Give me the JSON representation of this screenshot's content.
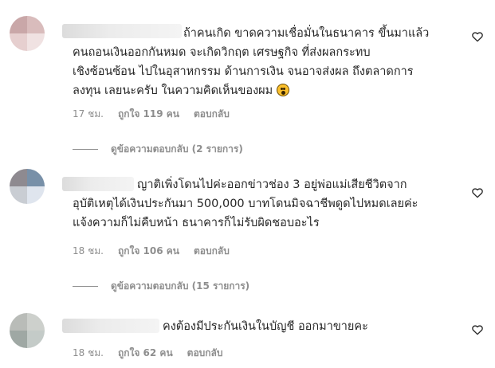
{
  "comments": [
    {
      "lines": [
        "ถ้าคนเกิด ขาดความเชื่อมั่นในธนาคาร ขึ้นมาแล้ว",
        "คนถอนเงินออกกันหมด จะเกิดวิกฤต เศรษฐกิจ ที่ส่งผลกระทบ",
        "เชิงซ้อนซ้อน ไปในอุสาหกรรม ด้านการเงิน จนอาจส่งผล ถึงตลาดการ",
        "ลงทุน เลยนะครับ ในความคิดเห็นของผม"
      ],
      "emoji": "astonished-face-icon",
      "time": "17 ชม.",
      "likes": "ถูกใจ 119 คน",
      "reply": "ตอบกลับ",
      "view_replies": "ดูข้อความตอบกลับ (2 รายการ)"
    },
    {
      "lines": [
        "ญาติเพิ่งโดนไปค่ะออกข่าวช่อง 3 อยู่พ่อแม่เสียชีวิตจาก",
        "อุบัติเหตุได้เงินประกันมา 500,000 บาทโดนมิจฉาชีพดูดไปหมดเลยค่ะ",
        "แจ้งความก็ไม่คืบหน้า ธนาคารก็ไม่รับผิดชอบอะไร"
      ],
      "time": "18 ชม.",
      "likes": "ถูกใจ 106 คน",
      "reply": "ตอบกลับ",
      "view_replies": "ดูข้อความตอบกลับ (15 รายการ)"
    },
    {
      "lines": [
        "คงต้องมีประกันเงินในบัญชี ออกมาขายคะ"
      ],
      "time": "18 ชม.",
      "likes": "ถูกใจ 62 คน",
      "reply": "ตอบกลับ"
    }
  ],
  "icons": {
    "like": "heart-outline-icon"
  },
  "colors": {
    "text": "#262626",
    "muted": "#8e8e8e"
  }
}
